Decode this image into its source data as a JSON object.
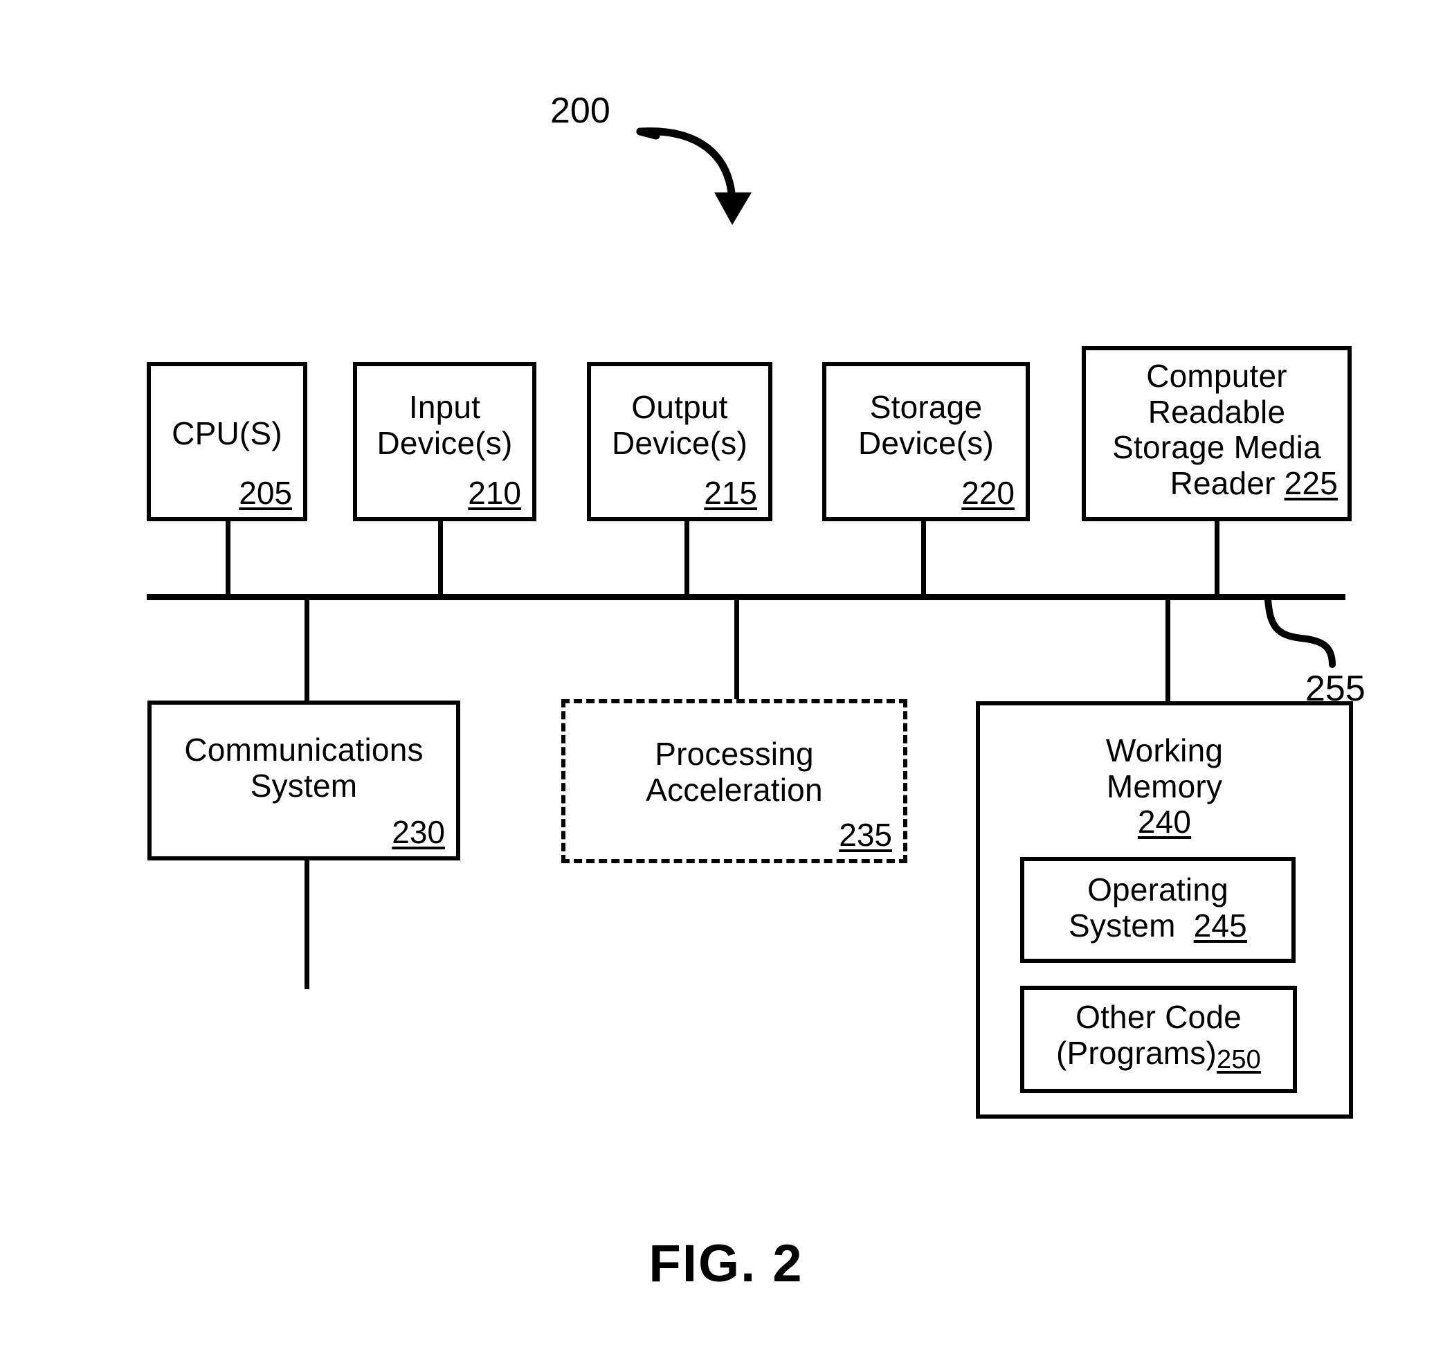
{
  "figure": {
    "caption": "FIG. 2",
    "system_ref": "200",
    "bus_ref": "255"
  },
  "top_row": [
    {
      "title": "CPU(S)",
      "ref": "205",
      "name": "cpu"
    },
    {
      "title_line1": "Input",
      "title_line2": "Device(s)",
      "ref": "210",
      "name": "input-devices"
    },
    {
      "title_line1": "Output",
      "title_line2": "Device(s)",
      "ref": "215",
      "name": "output-devices"
    },
    {
      "title_line1": "Storage",
      "title_line2": "Device(s)",
      "ref": "220",
      "name": "storage-devices"
    },
    {
      "title_line1": "Computer",
      "title_line2": "Readable",
      "title_line3": "Storage Media",
      "title_line4": "Reader",
      "ref": "225",
      "name": "computer-readable-storage-media-reader"
    }
  ],
  "bottom_row": {
    "communications": {
      "title_line1": "Communications",
      "title_line2": "System",
      "ref": "230"
    },
    "processing_acceleration": {
      "title_line1": "Processing",
      "title_line2": "Acceleration",
      "ref": "235",
      "style": "dashed"
    },
    "working_memory": {
      "title_line1": "Working",
      "title_line2": "Memory",
      "ref": "240",
      "children": {
        "operating_system": {
          "title_line1": "Operating",
          "title_line2": "System",
          "ref": "245"
        },
        "other_code": {
          "title_line1": "Other Code",
          "title_line2": "(Programs)",
          "ref": "250"
        }
      }
    }
  },
  "colors": {
    "stroke": "#000000",
    "background": "#ffffff"
  }
}
